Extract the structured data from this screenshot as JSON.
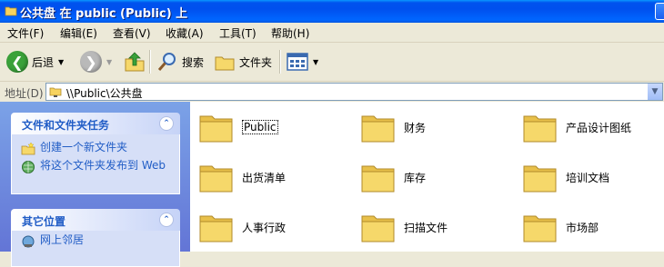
{
  "window": {
    "title": "公共盘 在 public (Public) 上"
  },
  "menu": [
    "文件(F)",
    "编辑(E)",
    "查看(V)",
    "收藏(A)",
    "工具(T)",
    "帮助(H)"
  ],
  "toolbar": {
    "back": "后退",
    "search": "搜索",
    "folders": "文件夹"
  },
  "address": {
    "label": "地址(D)",
    "value": "\\\\Public\\公共盘"
  },
  "tasks_panel": {
    "title": "文件和文件夹任务",
    "items": [
      {
        "label": "创建一个新文件夹",
        "icon": "new-folder-icon"
      },
      {
        "label": "将这个文件夹发布到 Web",
        "icon": "publish-web-icon"
      }
    ]
  },
  "places_panel": {
    "title": "其它位置",
    "items": [
      {
        "label": "网上邻居",
        "icon": "network-icon"
      }
    ]
  },
  "folders": [
    "Public",
    "财务",
    "产品设计图纸",
    "出货清单",
    "库存",
    "培训文档",
    "人事行政",
    "扫描文件",
    "市场部"
  ],
  "colors": {
    "title_bar": "#0054e3",
    "task_pane": "#7ba2e7",
    "link": "#215dc6",
    "folder": "#f6d86a"
  }
}
